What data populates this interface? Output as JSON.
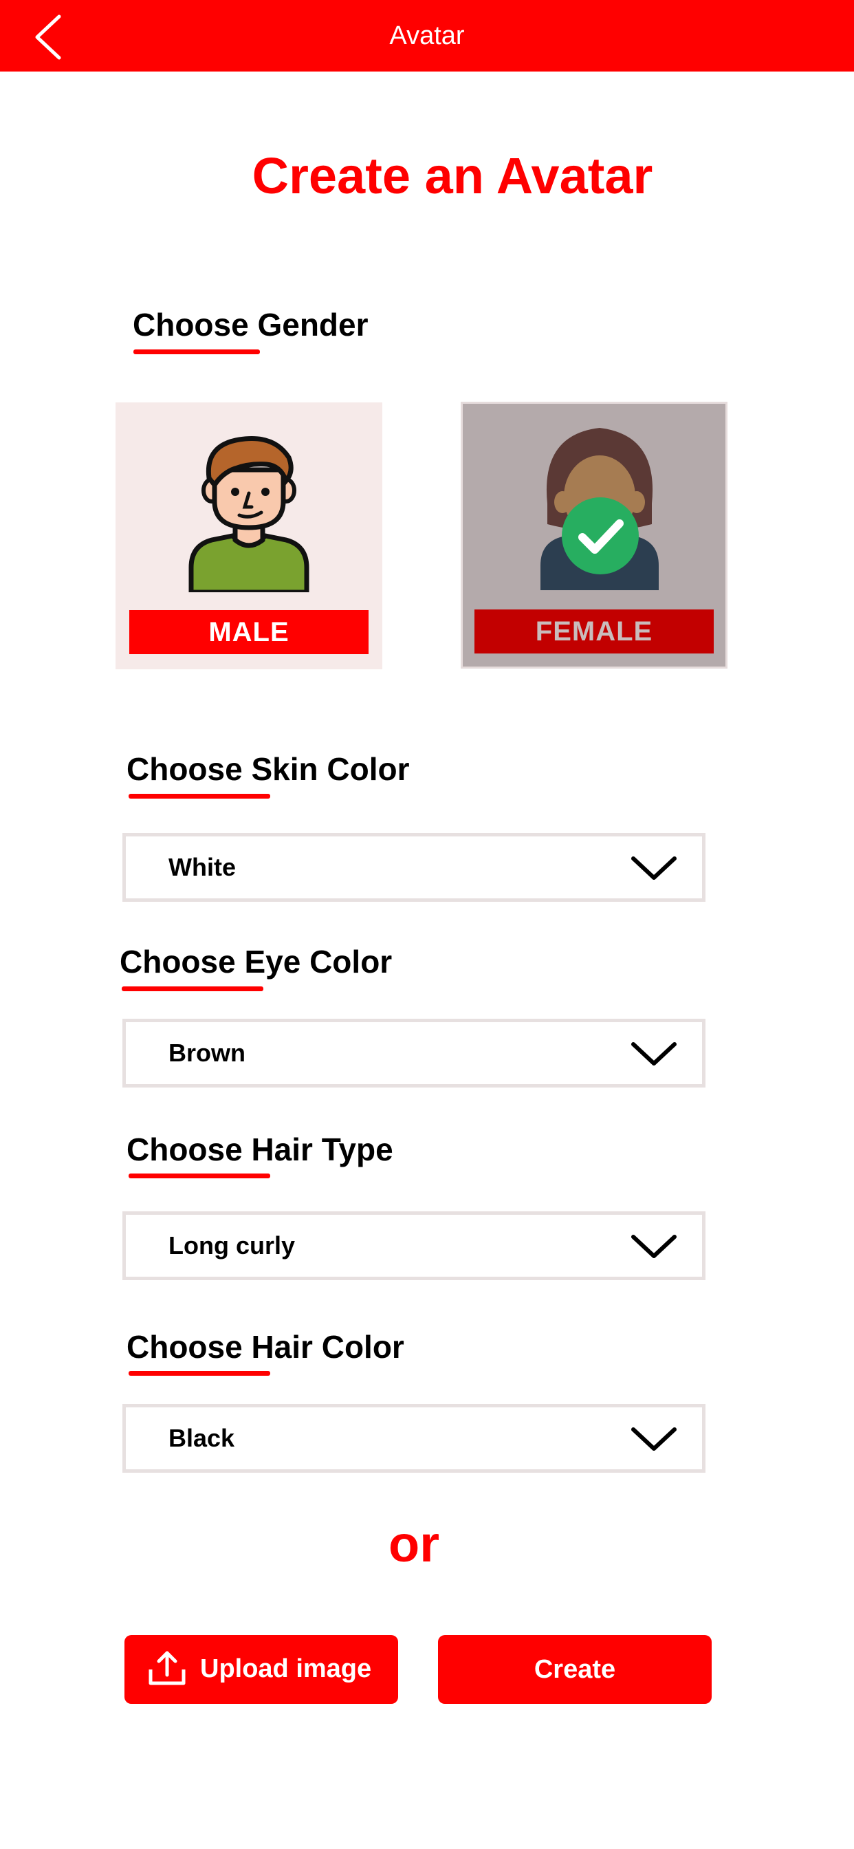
{
  "header": {
    "title": "Avatar",
    "back_icon": "chevron-left-icon"
  },
  "page_title": "Create an Avatar",
  "gender": {
    "label": "Choose Gender",
    "options": [
      {
        "label": "MALE",
        "selected": false
      },
      {
        "label": "FEMALE",
        "selected": true
      }
    ],
    "selected_icon": "check-circle-icon"
  },
  "skin_color": {
    "label": "Choose Skin Color",
    "value": "White"
  },
  "eye_color": {
    "label": "Choose Eye Color",
    "value": "Brown"
  },
  "hair_type": {
    "label": "Choose Hair Type",
    "value": "Long curly"
  },
  "hair_color": {
    "label": "Choose Hair Color",
    "value": "Black"
  },
  "divider_text": "or",
  "actions": {
    "upload_label": "Upload image",
    "create_label": "Create",
    "upload_icon": "upload-icon"
  },
  "colors": {
    "accent": "#ff0000",
    "selected_check": "#27ae60"
  }
}
